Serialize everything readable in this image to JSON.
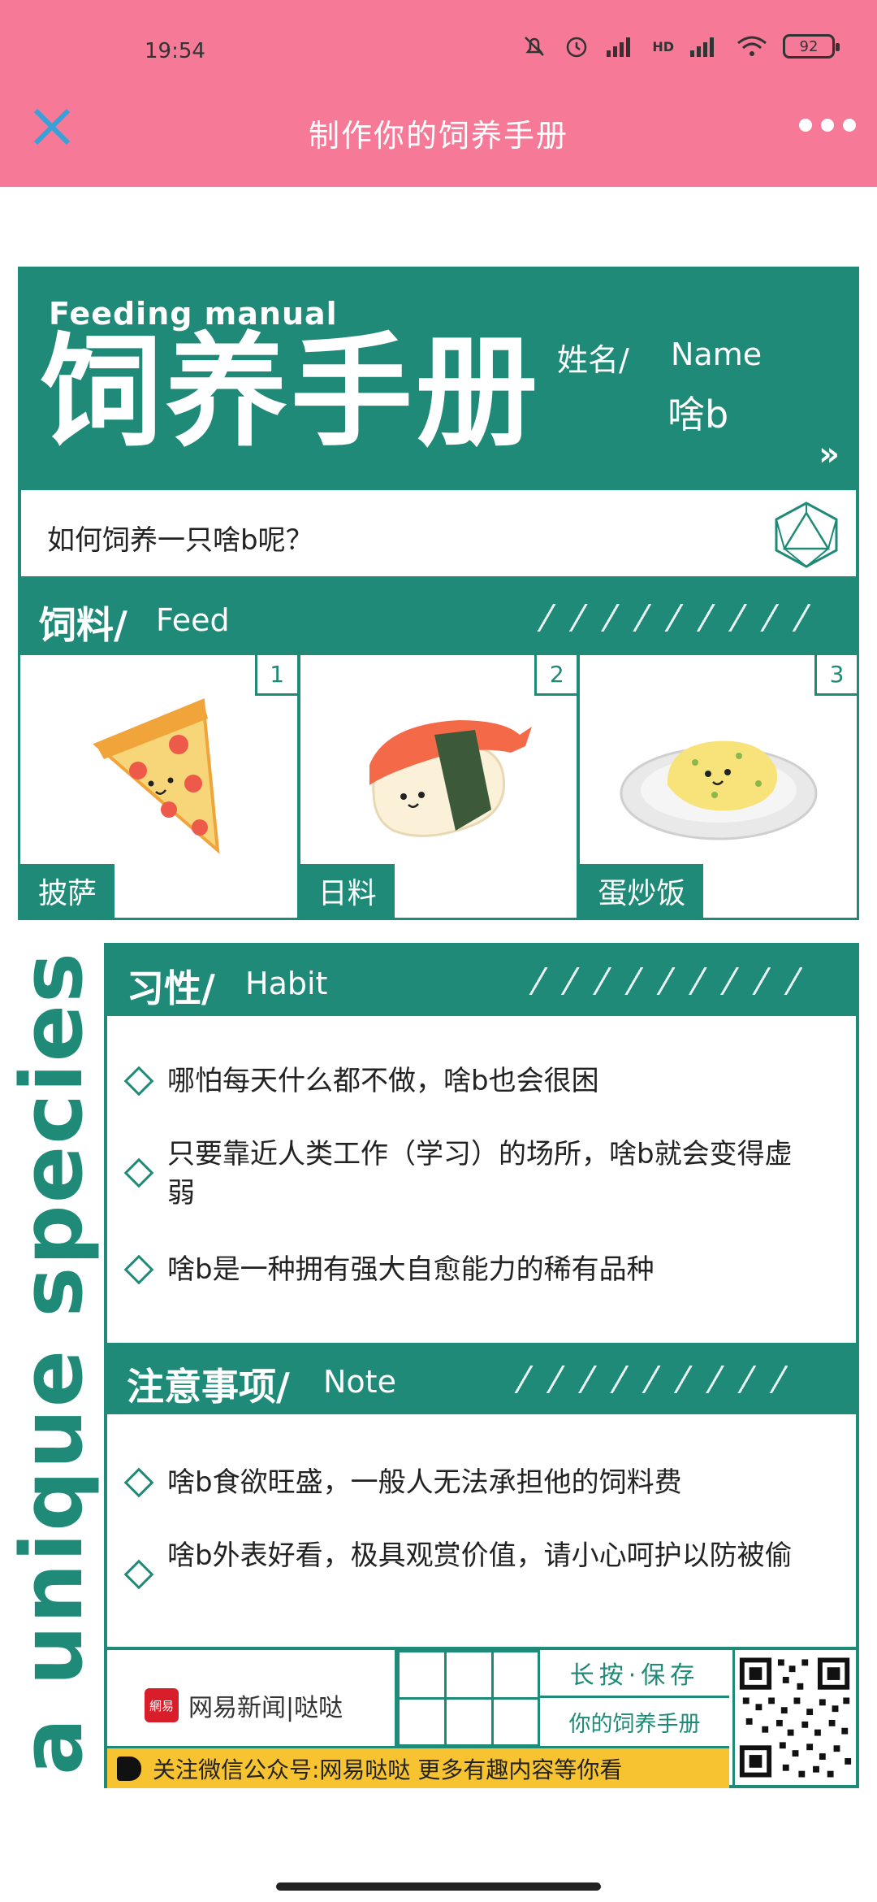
{
  "status_bar": {
    "time": "19:54",
    "battery": "92",
    "signal_label": "HD"
  },
  "title_bar": {
    "title": "制作你的饲养手册"
  },
  "manual": {
    "feeding_label": "Feeding manual",
    "big_title": "饲养手册",
    "name_cn": "姓名/",
    "name_en": "Name",
    "name_value": "啥b",
    "chevrons": "»",
    "question": "如何饲养一只啥b呢？",
    "feed_section": {
      "title": "饲料/",
      "en": "Feed"
    },
    "feeds": [
      {
        "num": "1",
        "label": "披萨"
      },
      {
        "num": "2",
        "label": "日料"
      },
      {
        "num": "3",
        "label": "蛋炒饭"
      }
    ],
    "vertical_text": "a unique species",
    "habit_section": {
      "title": "习性/",
      "en": "Habit"
    },
    "habits": [
      "哪怕每天什么都不做，啥b也会很困",
      "只要靠近人类工作（学习）的场所，啥b就会变得虚弱",
      "啥b是一种拥有强大自愈能力的稀有品种"
    ],
    "note_section": {
      "title": "注意事项/",
      "en": "Note"
    },
    "notes": [
      "啥b食欲旺盛，一般人无法承担他的饲料费",
      "啥b外表好看，极具观赏价值，请小心呵护以防被偷"
    ],
    "footer": {
      "brand_logo": "網易",
      "brand": "网易新闻|哒哒",
      "save_1": "长按·保存",
      "save_2": "你的饲养手册",
      "follow": "关注微信公众号:网易哒哒 更多有趣内容等你看"
    }
  },
  "colors": {
    "pink": "#f67a97",
    "teal": "#1f8a77",
    "yellow": "#f7c331"
  }
}
